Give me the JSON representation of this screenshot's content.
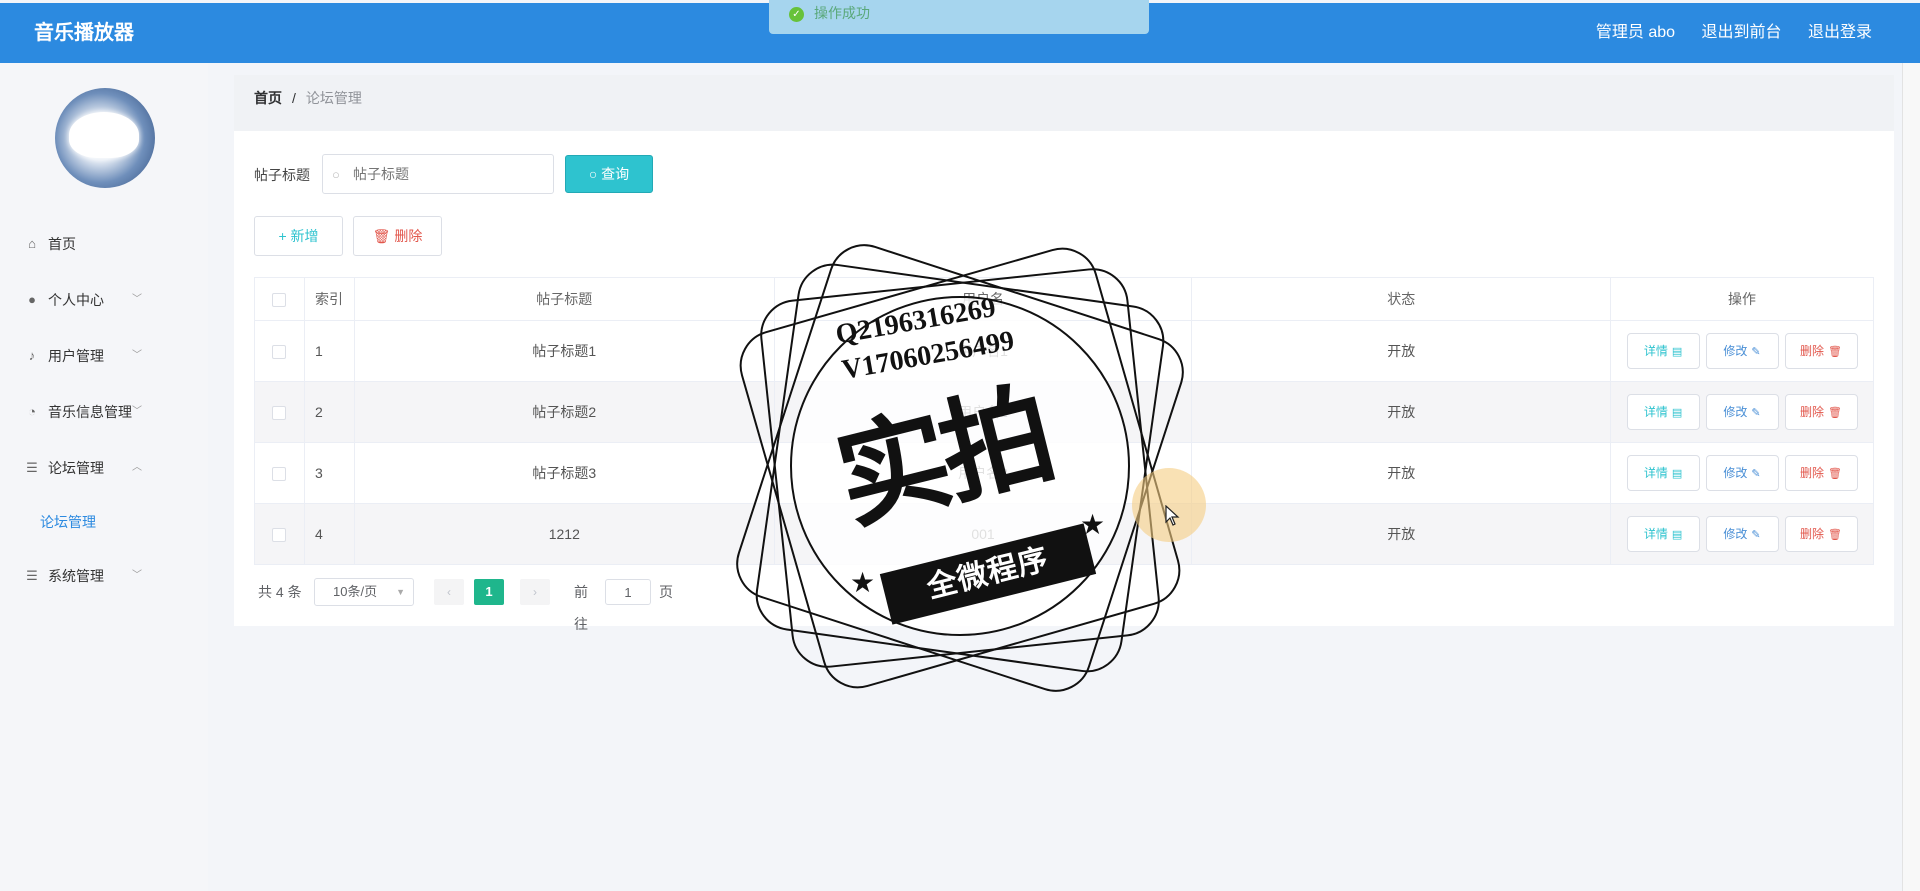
{
  "header": {
    "app_title": "音乐播放器",
    "user_label": "管理员 abo",
    "to_front": "退出到前台",
    "logout": "退出登录"
  },
  "toast": {
    "text": "操作成功",
    "icon": "check-circle-icon"
  },
  "sidebar": {
    "avatar": "avatar",
    "items": [
      {
        "label": "首页",
        "icon": "home-icon",
        "arrow": ""
      },
      {
        "label": "个人中心",
        "icon": "user-icon",
        "arrow": "chevron-down"
      },
      {
        "label": "用户管理",
        "icon": "microphone-icon",
        "arrow": "chevron-down"
      },
      {
        "label": "音乐信息管理",
        "icon": "compass-icon",
        "arrow": "chevron-down"
      },
      {
        "label": "论坛管理",
        "icon": "menu-icon",
        "arrow": "chevron-up"
      },
      {
        "label": "论坛管理",
        "icon": "",
        "arrow": "",
        "sub": true
      },
      {
        "label": "系统管理",
        "icon": "menu-icon",
        "arrow": "chevron-down"
      }
    ]
  },
  "breadcrumb": {
    "home": "首页",
    "separator": "/",
    "current": "论坛管理"
  },
  "search": {
    "label": "帖子标题",
    "placeholder": "帖子标题",
    "button": "查询"
  },
  "actions": {
    "add": "新增",
    "delete": "删除"
  },
  "table": {
    "headers": [
      "索引",
      "帖子标题",
      "用户名",
      "状态",
      "操作"
    ],
    "rows": [
      {
        "index": "1",
        "title": "帖子标题1",
        "user": "用户名1",
        "status": "开放"
      },
      {
        "index": "2",
        "title": "帖子标题2",
        "user": "用户名2",
        "status": "开放"
      },
      {
        "index": "3",
        "title": "帖子标题3",
        "user": "用户名3",
        "status": "开放"
      },
      {
        "index": "4",
        "title": "1212",
        "user": "001",
        "status": "开放"
      }
    ],
    "op_labels": {
      "detail": "详情",
      "edit": "修改",
      "remove": "删除"
    }
  },
  "pagination": {
    "total": "共 4 条",
    "page_size": "10条/页",
    "current_page": "1",
    "goto_label": "前往",
    "goto_value": "1",
    "page_unit": "页"
  },
  "watermark": {
    "line1": "Q2196316269",
    "line2": "V17060256499",
    "big": "实拍",
    "banner": "全微程序"
  },
  "colors": {
    "header_bg": "#2c8ae0",
    "accent_cyan": "#2ec3cf",
    "danger": "#e2574c",
    "page_active": "#1fb68c"
  }
}
